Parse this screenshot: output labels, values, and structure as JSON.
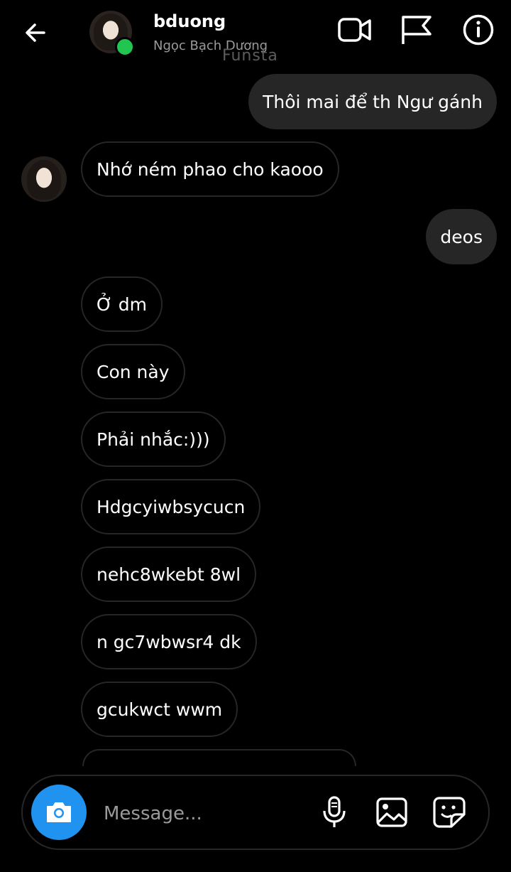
{
  "header": {
    "name": "bduong",
    "subtitle": "Ngọc Bạch Dương",
    "watermark": "Funsta"
  },
  "icons": {
    "back": "arrow-left-icon",
    "video": "video-camera-icon",
    "report": "flag-icon",
    "info": "info-icon",
    "camera": "camera-icon",
    "mic": "microphone-icon",
    "gallery": "image-icon",
    "sticker": "sticker-icon"
  },
  "colors": {
    "background": "#000000",
    "outgoing_bubble": "#262626",
    "incoming_border": "#262626",
    "camera_button": "#1f93ef",
    "online": "#23c552"
  },
  "messages": [
    {
      "direction": "out",
      "text": "Thôi mai để th Ngư gánh"
    },
    {
      "direction": "in",
      "text": "Nhớ ném phao cho kaooo"
    },
    {
      "direction": "out",
      "text": "deos"
    },
    {
      "direction": "in",
      "text": "Ở dm"
    },
    {
      "direction": "in",
      "text": "Con này"
    },
    {
      "direction": "in",
      "text": "Phải nhắc:)))"
    },
    {
      "direction": "in",
      "text": "Hdgcyiwbsycucn"
    },
    {
      "direction": "in",
      "text": "nehc8wkebt 8wl"
    },
    {
      "direction": "in",
      "text": "n gc7wbwsr4 dk"
    },
    {
      "direction": "in",
      "text": "gcukwct wwm"
    }
  ],
  "composer": {
    "placeholder": "Message..."
  }
}
